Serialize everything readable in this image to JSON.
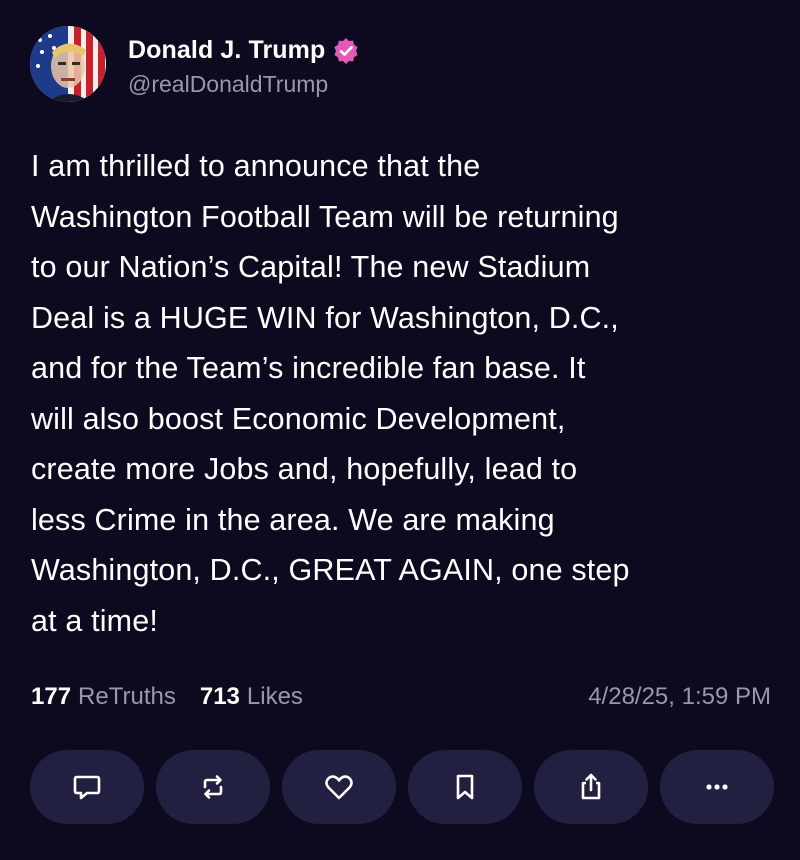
{
  "post": {
    "author": {
      "display_name": "Donald J. Trump",
      "handle": "@realDonaldTrump",
      "verified_color": "#e45ab8",
      "avatar_icon": "avatar-flag-portrait"
    },
    "body": "I am thrilled to announce that the\nWashington Football Team will be returning\nto our Nation’s Capital! The new Stadium\nDeal is a HUGE WIN for Washington, D.C.,\nand for the Team’s incredible fan base. It\nwill also boost Economic Development,\ncreate more Jobs and, hopefully, lead to\nless Crime in the area. We are making\nWashington, D.C., GREAT AGAIN, one step\nat a time!",
    "stats": {
      "retruths_count": "177",
      "retruths_label": "ReTruths",
      "likes_count": "713",
      "likes_label": "Likes"
    },
    "timestamp": "4/28/25, 1:59 PM"
  },
  "actions": [
    {
      "name": "reply",
      "icon": "speech-bubble-icon"
    },
    {
      "name": "retruth",
      "icon": "repost-icon"
    },
    {
      "name": "like",
      "icon": "heart-icon"
    },
    {
      "name": "bookmark",
      "icon": "bookmark-icon"
    },
    {
      "name": "share",
      "icon": "share-icon"
    },
    {
      "name": "more",
      "icon": "more-icon"
    }
  ],
  "colors": {
    "background": "#0d0a1f",
    "button_background": "#222040",
    "muted_text": "#9a97aa"
  }
}
